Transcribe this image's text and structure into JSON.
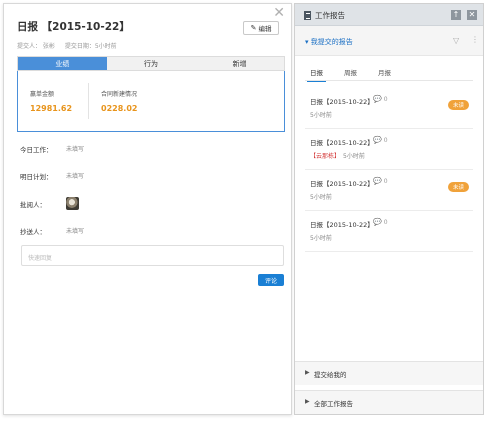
{
  "detail": {
    "title": "日报 【2015-10-22】",
    "edit_label": "编辑",
    "submitter": "提交人： 张彬",
    "submit_date": "提交日期：5小时前",
    "tabs": [
      "业绩",
      "行为",
      "新增"
    ],
    "stats": [
      {
        "label": "赢单金额",
        "value": "12981.62"
      },
      {
        "label": "合同新建情况",
        "value": "0228.02"
      }
    ],
    "fields": {
      "today_label": "今日工作：",
      "today_value": "未填写",
      "tomorrow_label": "明日计划：",
      "tomorrow_value": "未填写",
      "reviewer_label": "批阅人：",
      "cc_label": "抄送人：",
      "cc_value": "未填写"
    },
    "reply_placeholder": "快速回复",
    "comment_label": "评论"
  },
  "panel": {
    "title": "工作报告",
    "mine_label": "我提交的报告",
    "sub_tabs": [
      "日报",
      "周报",
      "月报"
    ],
    "items": [
      {
        "title": "日报【2015-10-22】",
        "count": "0",
        "time": "5小时前",
        "tag": "",
        "badge": "未读"
      },
      {
        "title": "日报【2015-10-22】",
        "count": "0",
        "time": "5小时前",
        "tag": "【云那栋】",
        "badge": ""
      },
      {
        "title": "日报【2015-10-22】",
        "count": "0",
        "time": "5小时前",
        "tag": "",
        "badge": "未读"
      },
      {
        "title": "日报【2015-10-22】",
        "count": "0",
        "time": "5小时前",
        "tag": "",
        "badge": ""
      }
    ],
    "submitted_to_me": "提交给我的",
    "all_reports": "全部工作报告"
  },
  "colors": {
    "accent": "#1a7fd4",
    "tab_active": "#4a8fd9",
    "stat_value": "#e8941c",
    "badge": "#f0a23a"
  }
}
